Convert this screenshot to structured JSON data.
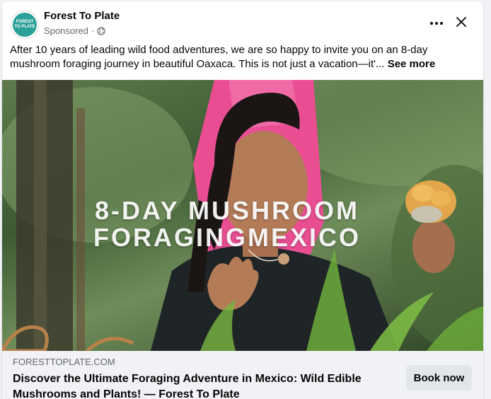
{
  "post": {
    "page_name": "Forest To Plate",
    "avatar_text": "FOREST TO PLATE",
    "sponsored_label": "Sponsored",
    "sponsored_separator": "·",
    "body_text": "After 10 years of leading wild food adventures, we are so happy to invite you on an 8-day mushroom foraging journey in beautiful Oaxaca. This is not just a vacation—it'...",
    "see_more_label": "See more",
    "media_overlay": {
      "line1": "8-DAY MUSHROOM",
      "line2": "FORAGINGMEXICO"
    },
    "link": {
      "domain": "FORESTTOPLATE.COM",
      "title": "Discover the Ultimate Foraging Adventure in Mexico: Wild Edible Mushrooms and Plants! — Forest To Plate",
      "cta_label": "Book now"
    }
  },
  "icons": {
    "more": "more-options-icon",
    "close": "close-icon",
    "privacy": "globe-icon"
  },
  "colors": {
    "background": "#f0f2f5",
    "text_primary": "#050505",
    "text_secondary": "#65676b",
    "button_bg": "#e2e5e9",
    "brand_teal": "#2aa198"
  }
}
